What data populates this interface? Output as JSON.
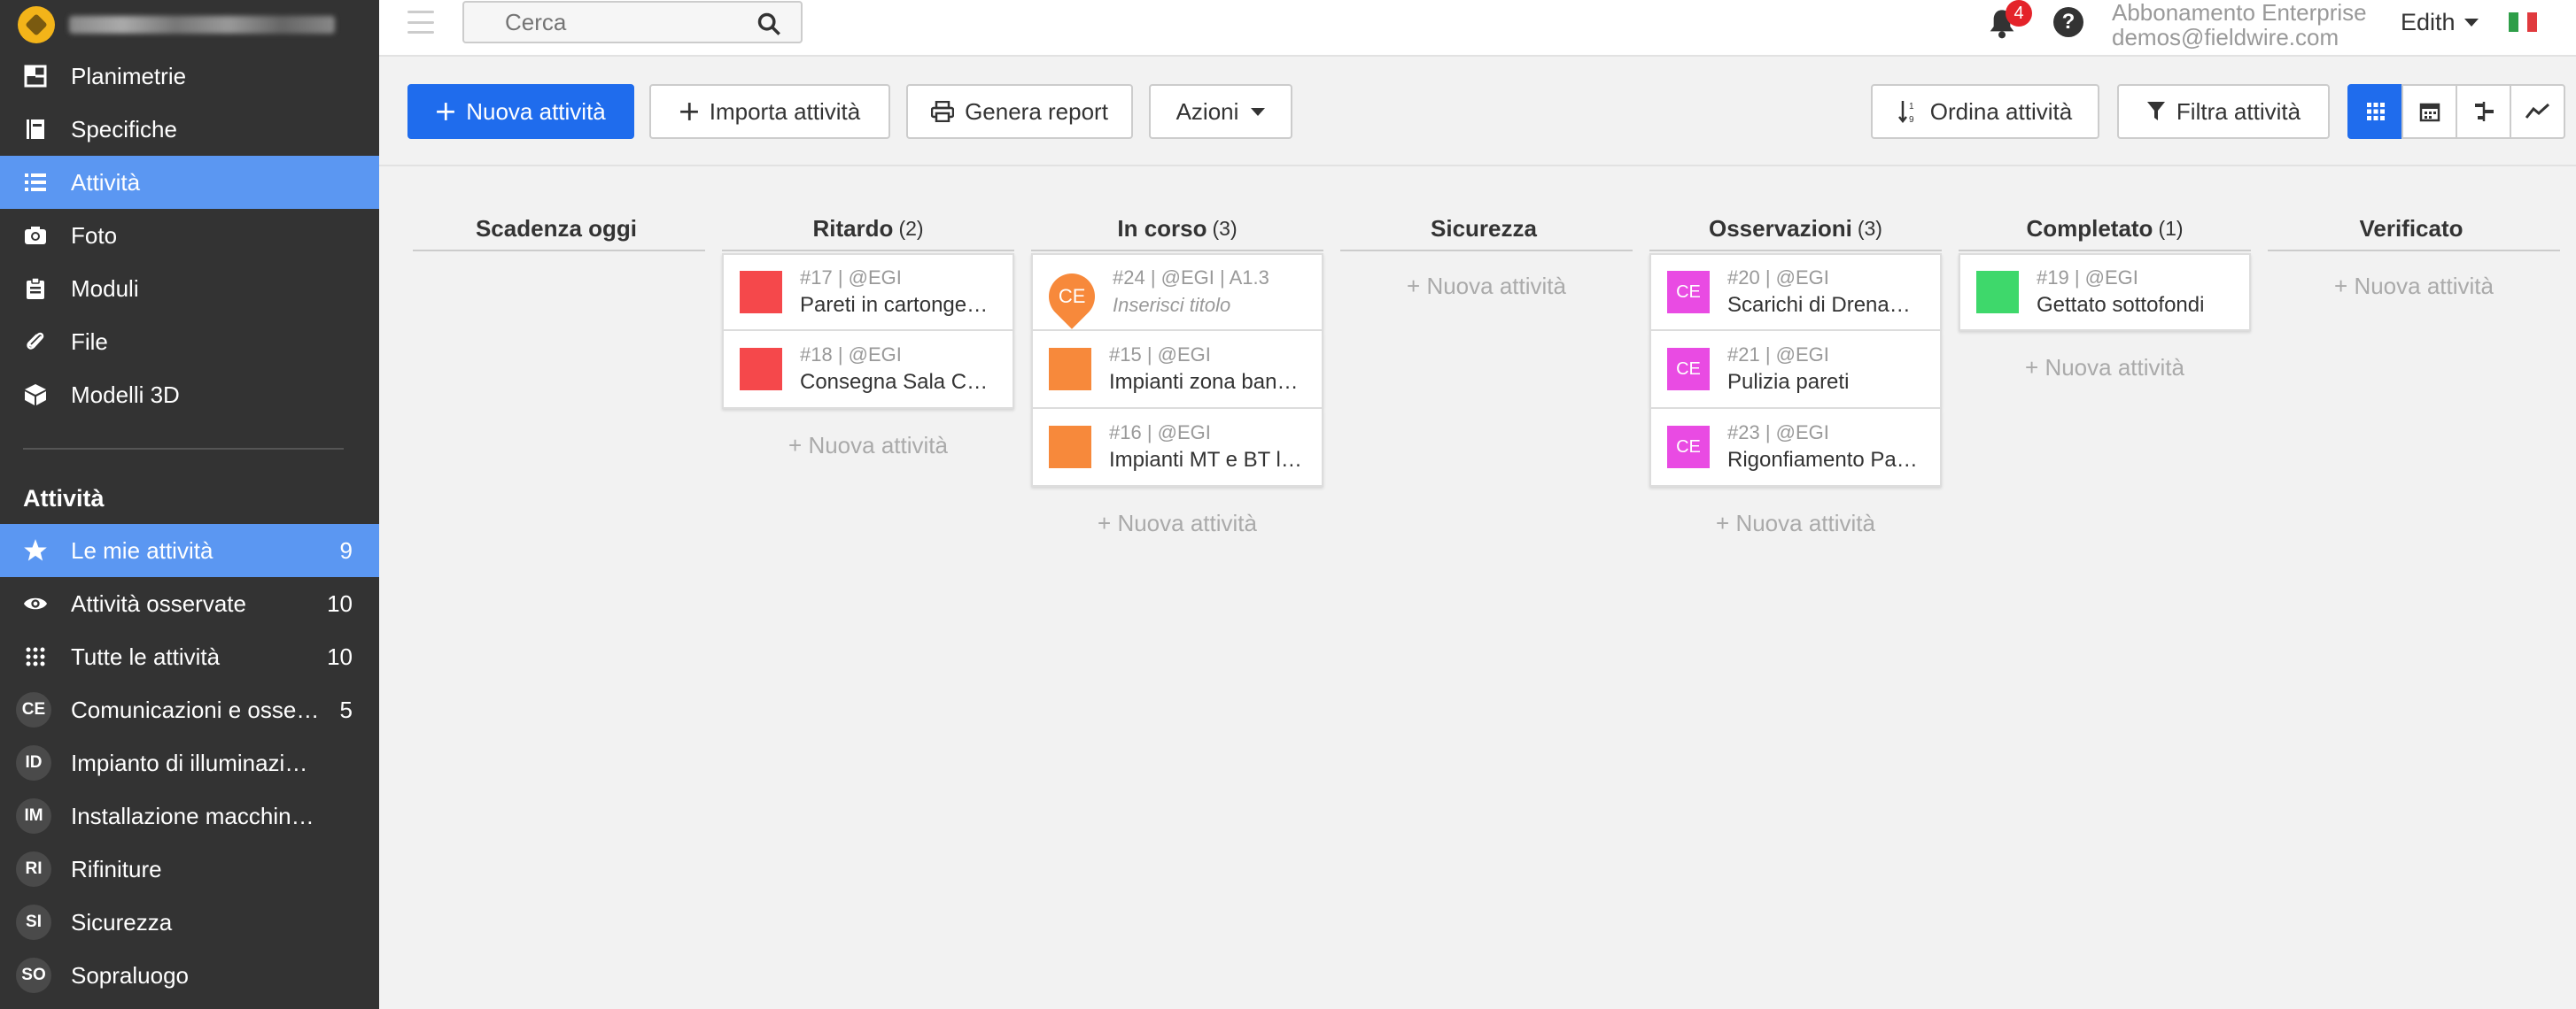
{
  "search": {
    "placeholder": "Cerca"
  },
  "notifications": {
    "count": "4"
  },
  "help": {
    "label": "?"
  },
  "account": {
    "plan": "Abbonamento Enterprise",
    "email": "demos@fieldwire.com"
  },
  "user": {
    "name": "Edith"
  },
  "sidebar": {
    "nav": [
      {
        "label": "Planimetrie",
        "icon": "floorplan-icon"
      },
      {
        "label": "Specifiche",
        "icon": "book-icon"
      },
      {
        "label": "Attività",
        "icon": "list-icon"
      },
      {
        "label": "Foto",
        "icon": "camera-icon"
      },
      {
        "label": "Moduli",
        "icon": "clipboard-icon"
      },
      {
        "label": "File",
        "icon": "paperclip-icon"
      },
      {
        "label": "Modelli 3D",
        "icon": "cube-icon"
      }
    ],
    "section_title": "Attività",
    "filters": [
      {
        "label": "Le mie attività",
        "count": "9",
        "icon": "star-icon"
      },
      {
        "label": "Attività osservate",
        "count": "10",
        "icon": "eye-icon"
      },
      {
        "label": "Tutte le attività",
        "count": "10",
        "icon": "grid-icon"
      }
    ],
    "categories": [
      {
        "badge": "CE",
        "label": "Comunicazioni e osse…",
        "count": "5"
      },
      {
        "badge": "ID",
        "label": "Impianto di illuminazi…",
        "count": ""
      },
      {
        "badge": "IM",
        "label": "Installazione macchin…",
        "count": ""
      },
      {
        "badge": "RI",
        "label": "Rifiniture",
        "count": ""
      },
      {
        "badge": "SI",
        "label": "Sicurezza",
        "count": ""
      },
      {
        "badge": "SO",
        "label": "Sopraluogo",
        "count": ""
      }
    ]
  },
  "toolbar": {
    "new_task": "Nuova attività",
    "import": "Importa attività",
    "report": "Genera report",
    "actions": "Azioni",
    "sort": "Ordina attività",
    "filter": "Filtra attività"
  },
  "colors": {
    "primary": "#1f6ced",
    "sidebar": "#333333",
    "active": "#5b97f2",
    "red": "#f5484b",
    "orange": "#f7893b",
    "magenta": "#e94be3",
    "green": "#3ed86b"
  },
  "board": {
    "add_label": "+ Nuova attività",
    "columns": [
      {
        "title": "Scadenza oggi",
        "count": "",
        "cards": [],
        "show_add": false
      },
      {
        "title": "Ritardo",
        "count": "(2)",
        "show_add": true,
        "cards": [
          {
            "meta": "#17 | @EGI",
            "title": "Pareti in cartongesso",
            "color": "#f5484b",
            "badge": ""
          },
          {
            "meta": "#18 | @EGI",
            "title": "Consegna Sala CED",
            "color": "#f5484b",
            "badge": ""
          }
        ]
      },
      {
        "title": "In corso",
        "count": "(3)",
        "show_add": true,
        "cards": [
          {
            "meta": "#24 | @EGI | A1.3",
            "title": "Inserisci titolo",
            "color": "#f7893b",
            "badge": "CE",
            "pin": true
          },
          {
            "meta": "#15 | @EGI",
            "title": "Impianti zona banc…",
            "color": "#f7893b",
            "badge": ""
          },
          {
            "meta": "#16 | @EGI",
            "title": "Impianti MT e BT lo…",
            "color": "#f7893b",
            "badge": ""
          }
        ]
      },
      {
        "title": "Sicurezza",
        "count": "",
        "show_add": true,
        "cards": []
      },
      {
        "title": "Osservazioni",
        "count": "(3)",
        "show_add": true,
        "cards": [
          {
            "meta": "#20 | @EGI",
            "title": "Scarichi di Drenaggio",
            "color": "#e94be3",
            "badge": "CE"
          },
          {
            "meta": "#21 | @EGI",
            "title": "Pulizia pareti",
            "color": "#e94be3",
            "badge": "CE"
          },
          {
            "meta": "#23 | @EGI",
            "title": "Rigonfiamento Pan…",
            "color": "#e94be3",
            "badge": "CE"
          }
        ]
      },
      {
        "title": "Completato",
        "count": "(1)",
        "show_add": true,
        "cards": [
          {
            "meta": "#19 | @EGI",
            "title": "Gettato sottofondi",
            "color": "#3ed86b",
            "badge": ""
          }
        ]
      },
      {
        "title": "Verificato",
        "count": "",
        "show_add": true,
        "cards": []
      }
    ]
  }
}
